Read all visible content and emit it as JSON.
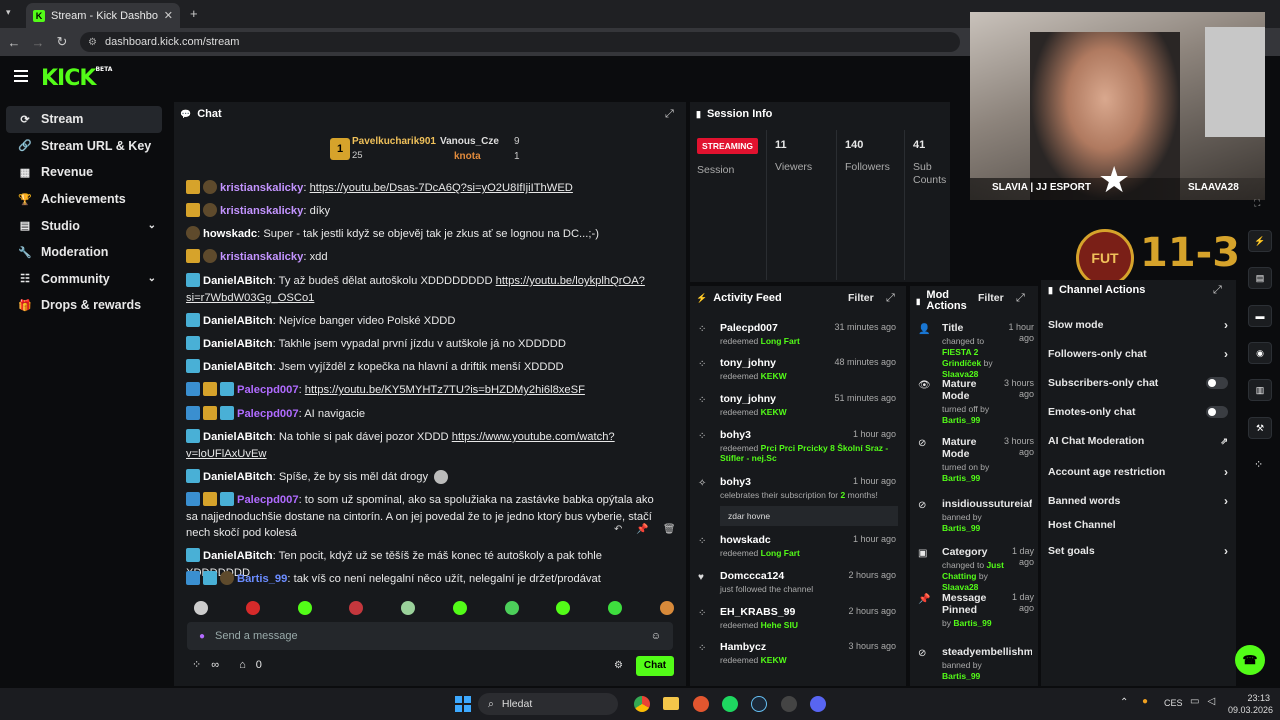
{
  "browser": {
    "tab_title": "Stream - Kick Dashboard",
    "url": "dashboard.kick.com/stream"
  },
  "sidebar": {
    "items": [
      {
        "label": "Stream",
        "icon": "stream-icon",
        "active": true
      },
      {
        "label": "Stream URL & Key",
        "icon": "link-icon"
      },
      {
        "label": "Revenue",
        "icon": "revenue-icon"
      },
      {
        "label": "Achievements",
        "icon": "trophy-icon"
      },
      {
        "label": "Studio",
        "icon": "studio-icon",
        "chevron": true
      },
      {
        "label": "Moderation",
        "icon": "wrench-icon"
      },
      {
        "label": "Community",
        "icon": "community-icon",
        "chevron": true
      },
      {
        "label": "Drops & rewards",
        "icon": "gift-icon"
      }
    ]
  },
  "chat": {
    "title": "Chat",
    "leaderboard": [
      {
        "rank": "1",
        "name": "Pavelkucharik901",
        "value": "25"
      },
      {
        "name": "Vanous_Cze",
        "value": "9"
      },
      {
        "name": "knota",
        "value": "1"
      }
    ],
    "messages": [
      {
        "user": "kristianskalicky",
        "color": "#c394ff",
        "text": "",
        "link": "https://youtu.be/Dsas-7DcA6Q?si=yO2U8IfIjiIThWED"
      },
      {
        "user": "kristianskalicky",
        "color": "#c394ff",
        "text": "díky"
      },
      {
        "user": "howskadc",
        "color": "#ffffff",
        "text": "Super - tak jestli když se objevěj tak je zkus ať se lognou na DC...;-)"
      },
      {
        "user": "kristianskalicky",
        "color": "#c394ff",
        "text": "xdd"
      },
      {
        "user": "DanielABitch",
        "color": "#ffffff",
        "text": "Ty až budeš dělat autoškolu XDDDDDDDD",
        "link": "https://youtu.be/loykplhQrOA?si=r7WbdW03Gg_OSCo1"
      },
      {
        "user": "DanielABitch",
        "color": "#ffffff",
        "text": "Nejvíce banger video Polské XDDD"
      },
      {
        "user": "DanielABitch",
        "color": "#ffffff",
        "text": "Takhle jsem vypadal první jízdu v autškole já no XDDDDD"
      },
      {
        "user": "DanielABitch",
        "color": "#ffffff",
        "text": "Jsem vyjížděl z kopečka na hlavní a driftik menší XDDDD"
      },
      {
        "user": "Palecpd007",
        "color": "#b06bff",
        "text": "",
        "link": "https://youtu.be/KY5MYHTz7TU?is=bHZDMy2hi6l8xeSF"
      },
      {
        "user": "Palecpd007",
        "color": "#b06bff",
        "text": "AI navigacie"
      },
      {
        "user": "DanielABitch",
        "color": "#ffffff",
        "text": "Na tohle si pak dávej pozor XDDD",
        "link": "https://www.youtube.com/watch?v=loUFlAxUvEw"
      },
      {
        "user": "DanielABitch",
        "color": "#ffffff",
        "text": "Spíše, že by sis měl dát drogy"
      },
      {
        "user": "Palecpd007",
        "color": "#b06bff",
        "text": "to som už spomínal, ako sa spolužiaka na zastávke babka opýtala ako sa najjednoduchšie dostane na cintorín. A on jej povedal že to je jedno ktorý bus vyberie, stačí nech skočí pod kolesá"
      },
      {
        "user": "DanielABitch",
        "color": "#ffffff",
        "text": "Ten pocit, když už se těšíš že máš konec té autoškoly a pak tohle XDDDDDDD"
      },
      {
        "user": "Bartis_99",
        "color": "#6b8cff",
        "text": "tak víš co není nelegalní něco užít, nelegalní je držet/prodávat"
      }
    ],
    "input_placeholder": "Send a message",
    "footer": {
      "infinity": "∞",
      "points": "0",
      "send_label": "Chat"
    }
  },
  "session": {
    "title": "Session Info",
    "status": "STREAMING",
    "stats": [
      {
        "label": "Session",
        "value": ""
      },
      {
        "label": "Viewers",
        "value": "11"
      },
      {
        "label": "Followers",
        "value": "140"
      },
      {
        "label": "Sub Counts",
        "value": "41"
      }
    ]
  },
  "activity": {
    "title": "Activity Feed",
    "filter": "Filter",
    "items": [
      {
        "name": "Palecpd007",
        "time": "31 minutes ago",
        "desc": "redeemed",
        "highlight": "Long Fart"
      },
      {
        "name": "tony_johny",
        "time": "48 minutes ago",
        "desc": "redeemed",
        "highlight": "KEKW"
      },
      {
        "name": "tony_johny",
        "time": "51 minutes ago",
        "desc": "redeemed",
        "highlight": "KEKW"
      },
      {
        "name": "bohy3",
        "time": "1 hour ago",
        "desc": "redeemed",
        "highlight": "Prci Prci Prcicky 8 Školní Sraz - Stifler - nej.Sc"
      },
      {
        "name": "bohy3",
        "time": "1 hour ago",
        "desc": "celebrates their subscription for",
        "highlight": "2",
        "suffix": "months!",
        "note": "zdar hovne"
      },
      {
        "name": "howskadc",
        "time": "1 hour ago",
        "desc": "redeemed",
        "highlight": "Long Fart"
      },
      {
        "name": "Domccca124",
        "time": "2 hours ago",
        "desc": "just followed the channel",
        "highlight": ""
      },
      {
        "name": "EH_KRABS_99",
        "time": "2 hours ago",
        "desc": "redeemed",
        "highlight": "Hehe SIU"
      },
      {
        "name": "Hambycz",
        "time": "3 hours ago",
        "desc": "redeemed",
        "highlight": "KEKW"
      }
    ]
  },
  "mod": {
    "title": "Mod Actions",
    "filter": "Filter",
    "items": [
      {
        "name": "Title",
        "time": "1 hour ago",
        "desc": "changed to",
        "highlight": "FIESTA 2 Grindíček",
        "by": "by",
        "who": "Slaava28"
      },
      {
        "name": "Mature Mode",
        "time": "3 hours ago",
        "desc": "turned off by",
        "who": "Bartis_99"
      },
      {
        "name": "Mature Mode",
        "time": "3 hours ago",
        "desc": "turned on by",
        "who": "Bartis_99"
      },
      {
        "name": "insidioussutureiafk",
        "time": "",
        "desc": "banned by",
        "who": "Bartis_99"
      },
      {
        "name": "Category",
        "time": "1 day ago",
        "desc": "changed to",
        "highlight": "Just Chatting",
        "by": "by",
        "who": "Slaava28"
      },
      {
        "name": "Message Pinned",
        "time": "1 day ago",
        "desc": "by",
        "who": "Bartis_99"
      },
      {
        "name": "steadyembellishme",
        "time": "",
        "desc": "banned by",
        "who": "Bartis_99"
      }
    ]
  },
  "channel_actions": {
    "title": "Channel Actions",
    "items": [
      {
        "label": "Slow mode",
        "control": "chevron"
      },
      {
        "label": "Followers-only chat",
        "control": "chevron"
      },
      {
        "label": "Subscribers-only chat",
        "control": "toggle"
      },
      {
        "label": "Emotes-only chat",
        "control": "toggle"
      },
      {
        "label": "AI Chat Moderation",
        "control": "external"
      },
      {
        "label": "Account age restriction",
        "control": "chevron"
      },
      {
        "label": "Banned words",
        "control": "chevron"
      },
      {
        "label": "Host Channel",
        "control": "none"
      },
      {
        "label": "Set goals",
        "control": "chevron"
      }
    ]
  },
  "overlay": {
    "cam_left": "SLAVIA | JJ ESPORT",
    "cam_right": "SLAAVA28",
    "fut": "FUT",
    "score": "11-3"
  },
  "taskbar": {
    "search": "Hledat",
    "lang": "CES",
    "time": "23:13",
    "date": "09.03.2026"
  },
  "colors": {
    "accent": "#53fc18",
    "streaming": "#e1122f"
  }
}
